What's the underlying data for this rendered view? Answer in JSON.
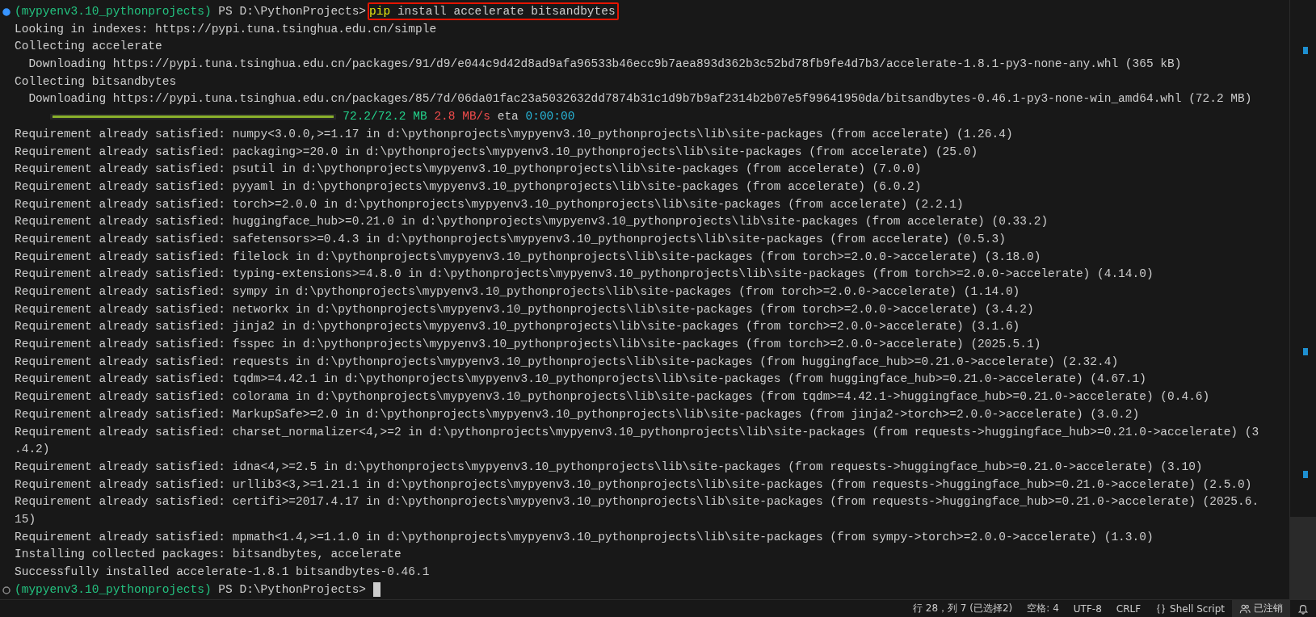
{
  "terminal": {
    "lines": [
      {
        "kind": "prompt",
        "marker_filled": true,
        "env": "(mypyenv3.10_pythonprojects)",
        "path": "PS D:\\PythonProjects>",
        "command_name": "pip",
        "command_args": "install accelerate bitsandbytes",
        "highlighted": true,
        "cursor": false
      },
      {
        "kind": "output",
        "text": "Looking in indexes: https://pypi.tuna.tsinghua.edu.cn/simple"
      },
      {
        "kind": "output",
        "text": "Collecting accelerate"
      },
      {
        "kind": "output",
        "text": "  Downloading https://pypi.tuna.tsinghua.edu.cn/packages/91/d9/e044c9d42d8ad9afa96533b46ecc9b7aea893d362b3c52bd78fb9fe4d7b3/accelerate-1.8.1-py3-none-any.whl (365 kB)"
      },
      {
        "kind": "output",
        "text": "Collecting bitsandbytes"
      },
      {
        "kind": "output",
        "text": "  Downloading https://pypi.tuna.tsinghua.edu.cn/packages/85/7d/06da01fac23a5032632dd7874b31c1d9b7b9af2314b2b07e5f99641950da/bitsandbytes-0.46.1-py3-none-win_amd64.whl (72.2 MB)"
      },
      {
        "kind": "progress",
        "level": 1,
        "size": "72.2/72.2 MB",
        "speed": "2.8 MB/s",
        "eta_label": "eta",
        "eta": "0:00:00"
      },
      {
        "kind": "output",
        "text": "Requirement already satisfied: numpy<3.0.0,>=1.17 in d:\\pythonprojects\\mypyenv3.10_pythonprojects\\lib\\site-packages (from accelerate) (1.26.4)"
      },
      {
        "kind": "output",
        "text": "Requirement already satisfied: packaging>=20.0 in d:\\pythonprojects\\mypyenv3.10_pythonprojects\\lib\\site-packages (from accelerate) (25.0)"
      },
      {
        "kind": "output",
        "text": "Requirement already satisfied: psutil in d:\\pythonprojects\\mypyenv3.10_pythonprojects\\lib\\site-packages (from accelerate) (7.0.0)"
      },
      {
        "kind": "output",
        "text": "Requirement already satisfied: pyyaml in d:\\pythonprojects\\mypyenv3.10_pythonprojects\\lib\\site-packages (from accelerate) (6.0.2)"
      },
      {
        "kind": "output",
        "text": "Requirement already satisfied: torch>=2.0.0 in d:\\pythonprojects\\mypyenv3.10_pythonprojects\\lib\\site-packages (from accelerate) (2.2.1)"
      },
      {
        "kind": "output",
        "text": "Requirement already satisfied: huggingface_hub>=0.21.0 in d:\\pythonprojects\\mypyenv3.10_pythonprojects\\lib\\site-packages (from accelerate) (0.33.2)"
      },
      {
        "kind": "output",
        "text": "Requirement already satisfied: safetensors>=0.4.3 in d:\\pythonprojects\\mypyenv3.10_pythonprojects\\lib\\site-packages (from accelerate) (0.5.3)"
      },
      {
        "kind": "output",
        "text": "Requirement already satisfied: filelock in d:\\pythonprojects\\mypyenv3.10_pythonprojects\\lib\\site-packages (from torch>=2.0.0->accelerate) (3.18.0)"
      },
      {
        "kind": "output",
        "text": "Requirement already satisfied: typing-extensions>=4.8.0 in d:\\pythonprojects\\mypyenv3.10_pythonprojects\\lib\\site-packages (from torch>=2.0.0->accelerate) (4.14.0)"
      },
      {
        "kind": "output",
        "text": "Requirement already satisfied: sympy in d:\\pythonprojects\\mypyenv3.10_pythonprojects\\lib\\site-packages (from torch>=2.0.0->accelerate) (1.14.0)"
      },
      {
        "kind": "output",
        "text": "Requirement already satisfied: networkx in d:\\pythonprojects\\mypyenv3.10_pythonprojects\\lib\\site-packages (from torch>=2.0.0->accelerate) (3.4.2)"
      },
      {
        "kind": "output",
        "text": "Requirement already satisfied: jinja2 in d:\\pythonprojects\\mypyenv3.10_pythonprojects\\lib\\site-packages (from torch>=2.0.0->accelerate) (3.1.6)"
      },
      {
        "kind": "output",
        "text": "Requirement already satisfied: fsspec in d:\\pythonprojects\\mypyenv3.10_pythonprojects\\lib\\site-packages (from torch>=2.0.0->accelerate) (2025.5.1)"
      },
      {
        "kind": "output",
        "text": "Requirement already satisfied: requests in d:\\pythonprojects\\mypyenv3.10_pythonprojects\\lib\\site-packages (from huggingface_hub>=0.21.0->accelerate) (2.32.4)"
      },
      {
        "kind": "output",
        "text": "Requirement already satisfied: tqdm>=4.42.1 in d:\\pythonprojects\\mypyenv3.10_pythonprojects\\lib\\site-packages (from huggingface_hub>=0.21.0->accelerate) (4.67.1)"
      },
      {
        "kind": "output",
        "text": "Requirement already satisfied: colorama in d:\\pythonprojects\\mypyenv3.10_pythonprojects\\lib\\site-packages (from tqdm>=4.42.1->huggingface_hub>=0.21.0->accelerate) (0.4.6)"
      },
      {
        "kind": "output",
        "text": "Requirement already satisfied: MarkupSafe>=2.0 in d:\\pythonprojects\\mypyenv3.10_pythonprojects\\lib\\site-packages (from jinja2->torch>=2.0.0->accelerate) (3.0.2)"
      },
      {
        "kind": "output",
        "text": "Requirement already satisfied: charset_normalizer<4,>=2 in d:\\pythonprojects\\mypyenv3.10_pythonprojects\\lib\\site-packages (from requests->huggingface_hub>=0.21.0->accelerate) (3"
      },
      {
        "kind": "output",
        "text": ".4.2)"
      },
      {
        "kind": "output",
        "text": "Requirement already satisfied: idna<4,>=2.5 in d:\\pythonprojects\\mypyenv3.10_pythonprojects\\lib\\site-packages (from requests->huggingface_hub>=0.21.0->accelerate) (3.10)"
      },
      {
        "kind": "output",
        "text": "Requirement already satisfied: urllib3<3,>=1.21.1 in d:\\pythonprojects\\mypyenv3.10_pythonprojects\\lib\\site-packages (from requests->huggingface_hub>=0.21.0->accelerate) (2.5.0)"
      },
      {
        "kind": "output",
        "text": "Requirement already satisfied: certifi>=2017.4.17 in d:\\pythonprojects\\mypyenv3.10_pythonprojects\\lib\\site-packages (from requests->huggingface_hub>=0.21.0->accelerate) (2025.6."
      },
      {
        "kind": "output",
        "text": "15)"
      },
      {
        "kind": "output",
        "text": "Requirement already satisfied: mpmath<1.4,>=1.1.0 in d:\\pythonprojects\\mypyenv3.10_pythonprojects\\lib\\site-packages (from sympy->torch>=2.0.0->accelerate) (1.3.0)"
      },
      {
        "kind": "output",
        "text": "Installing collected packages: bitsandbytes, accelerate"
      },
      {
        "kind": "output",
        "text": "Successfully installed accelerate-1.8.1 bitsandbytes-0.46.1"
      },
      {
        "kind": "prompt",
        "marker_filled": false,
        "env": "(mypyenv3.10_pythonprojects)",
        "path": "PS D:\\PythonProjects>",
        "highlighted": false,
        "cursor": true
      }
    ]
  },
  "status_bar": {
    "items": [
      {
        "kind": "position",
        "text": "行 28，列 7 (已选择2)"
      },
      {
        "kind": "plain",
        "text": "空格: 4"
      },
      {
        "kind": "plain",
        "text": "UTF-8"
      },
      {
        "kind": "plain",
        "text": "CRLF"
      },
      {
        "kind": "language",
        "text": "Shell Script"
      },
      {
        "kind": "accounts",
        "text": "已注销"
      },
      {
        "kind": "notifications"
      }
    ]
  }
}
